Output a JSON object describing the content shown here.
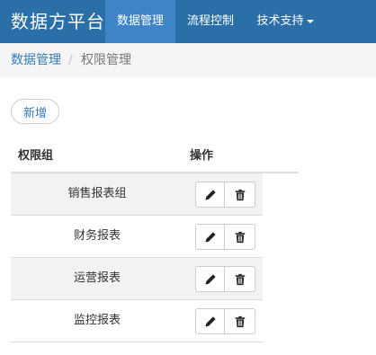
{
  "navbar": {
    "brand": "数据方平台",
    "items": [
      {
        "label": "数据管理",
        "active": true
      },
      {
        "label": "流程控制",
        "active": false
      },
      {
        "label": "技术支持",
        "active": false,
        "dropdown": true
      }
    ],
    "colors": {
      "background": "#2a6fa8",
      "active": "#3d85c6"
    }
  },
  "breadcrumb": {
    "parent": "数据管理",
    "separator": "/",
    "current": "权限管理"
  },
  "toolbar": {
    "add_label": "新增"
  },
  "table": {
    "headers": [
      "权限组",
      "操作"
    ],
    "rows": [
      {
        "name": "销售报表组"
      },
      {
        "name": "财务报表"
      },
      {
        "name": "运营报表"
      },
      {
        "name": "监控报表"
      }
    ],
    "row_actions": {
      "edit_icon": "pencil-icon",
      "delete_icon": "trash-icon"
    }
  }
}
